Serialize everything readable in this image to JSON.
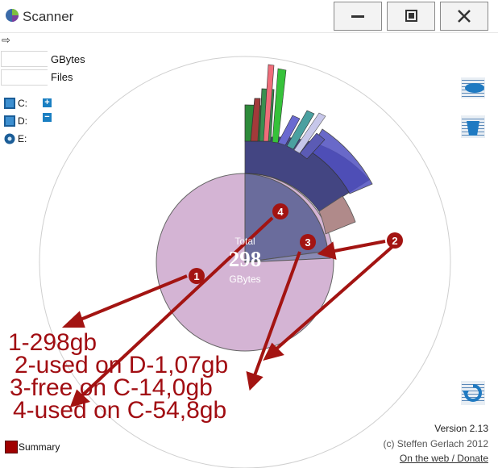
{
  "window": {
    "title": "Scanner"
  },
  "toolbar": {
    "back_glyph": "⇨"
  },
  "fields": {
    "gbytes_label": "GBytes",
    "files_label": "Files"
  },
  "drives": [
    {
      "label": "C:",
      "expand": "+"
    },
    {
      "label": "D:",
      "expand": "−"
    },
    {
      "label": "E:"
    }
  ],
  "chart_center": {
    "total_label": "Total",
    "total_value": "298",
    "unit": "GBytes"
  },
  "markers": [
    "1",
    "2",
    "3",
    "4"
  ],
  "annotations": [
    "1-298gb",
    "2-used on D-1,07gb",
    "3-free on C-14,0gb",
    "4-used on C-54,8gb"
  ],
  "footer": {
    "version": "Version 2.13",
    "copyright": "(c) Steffen Gerlach 2012",
    "link": "On the web / Donate",
    "summary": "Summary"
  },
  "colors": {
    "pie_fill": "#d4b4d4",
    "used_slice": "#6a6c9c",
    "arrow": "#a31412",
    "annotation_text": "#a10d12"
  }
}
